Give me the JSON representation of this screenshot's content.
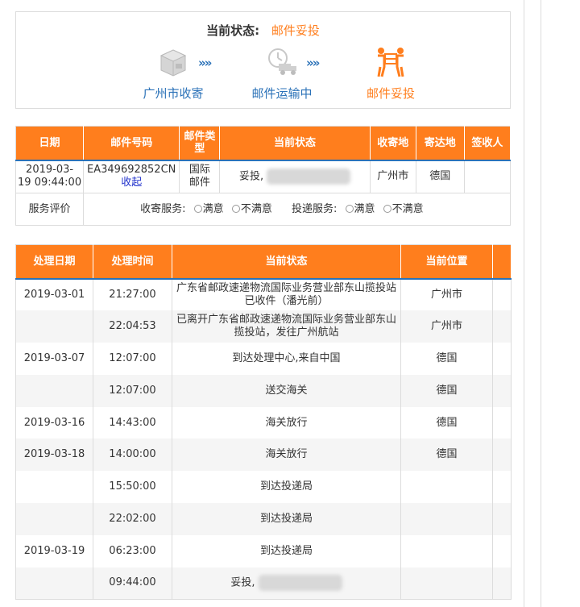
{
  "status_panel": {
    "label": "当前状态:",
    "value": "邮件妥投",
    "steps": [
      {
        "label": "广州市收寄",
        "icon": "box-icon"
      },
      {
        "label": "邮件运输中",
        "icon": "truck-clock-icon"
      },
      {
        "label": "邮件妥投",
        "icon": "delivery-person-icon"
      }
    ],
    "arrow": "»»"
  },
  "mail_table": {
    "headers": [
      "日期",
      "邮件号码",
      "邮件类型",
      "当前状态",
      "收寄地",
      "寄达地",
      "签收人"
    ],
    "row": {
      "date_line1": "2019-03-",
      "date_line2": "19 09:44:00",
      "number": "EA349692852CN",
      "collapse": "收起",
      "type_line1": "国际",
      "type_line2": "邮件",
      "status": "妥投,",
      "from": "广州市",
      "to": "德国",
      "signer": ""
    },
    "rating": {
      "label": "服务评价",
      "pickup_label": "收寄服务:",
      "delivery_label": "投递服务:",
      "satisfied": "满意",
      "unsatisfied": "不满意"
    }
  },
  "track_table": {
    "headers": [
      "处理日期",
      "处理时间",
      "当前状态",
      "当前位置"
    ],
    "rows": [
      {
        "date": "2019-03-01",
        "time": "21:27:00",
        "status": "广东省邮政速递物流国际业务营业部东山揽投站已收件（潘光前）",
        "location": "广州市"
      },
      {
        "date": "",
        "time": "22:04:53",
        "status": "已离开广东省邮政速递物流国际业务营业部东山揽投站，发往广州航站",
        "location": "广州市"
      },
      {
        "date": "2019-03-07",
        "time": "12:07:00",
        "status": "到达处理中心,来自中国",
        "location": "德国"
      },
      {
        "date": "",
        "time": "12:07:00",
        "status": "送交海关",
        "location": "德国"
      },
      {
        "date": "2019-03-16",
        "time": "14:43:00",
        "status": "海关放行",
        "location": "德国"
      },
      {
        "date": "2019-03-18",
        "time": "14:00:00",
        "status": "海关放行",
        "location": "德国"
      },
      {
        "date": "",
        "time": "15:50:00",
        "status": "到达投递局",
        "location": ""
      },
      {
        "date": "",
        "time": "22:02:00",
        "status": "到达投递局",
        "location": ""
      },
      {
        "date": "2019-03-19",
        "time": "06:23:00",
        "status": "到达投递局",
        "location": ""
      },
      {
        "date": "",
        "time": "09:44:00",
        "status": "妥投,",
        "location": "",
        "redacted": true
      }
    ]
  },
  "colors": {
    "accent_orange": "#ff7e1d",
    "link_blue": "#2b72b8",
    "header_text": "#ffffff"
  }
}
